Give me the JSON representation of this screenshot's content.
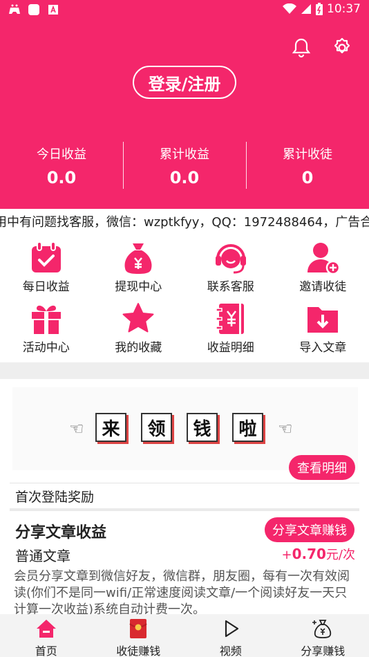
{
  "status_bar": {
    "time": "10:37"
  },
  "header": {
    "login_label": "登录/注册"
  },
  "stats": [
    {
      "label": "今日收益",
      "value": "0.0"
    },
    {
      "label": "累计收益",
      "value": "0.0"
    },
    {
      "label": "累计收徒",
      "value": "0"
    }
  ],
  "marquee": {
    "text": "用中有问题找客服，微信：wzptkfyy，QQ：1972488464，广告合"
  },
  "grid": [
    {
      "label": "每日收益",
      "icon": "calendar-check-icon"
    },
    {
      "label": "提现中心",
      "icon": "money-bag-icon"
    },
    {
      "label": "联系客服",
      "icon": "headset-icon"
    },
    {
      "label": "邀请收徒",
      "icon": "user-add-icon"
    },
    {
      "label": "活动中心",
      "icon": "gift-icon"
    },
    {
      "label": "我的收藏",
      "icon": "star-icon"
    },
    {
      "label": "收益明细",
      "icon": "ledger-icon"
    },
    {
      "label": "导入文章",
      "icon": "folder-import-icon"
    }
  ],
  "banner": {
    "chars": [
      "来",
      "领",
      "钱",
      "啦"
    ]
  },
  "card": {
    "detail_button": "查看明细",
    "first_login": "首次登陆奖励",
    "share_title": "分享文章收益",
    "share_button": "分享文章赚钱",
    "normal_article": "普通文章",
    "price_prefix": "+",
    "price_value": "0.70",
    "price_unit": "元/次",
    "description": "会员分享文章到微信好友，微信群，朋友圈，每有一次有效阅读(你们不是同一wifi/正常速度阅读文章/一个阅读好友一天只计算一次收益)系统自动计费一次。"
  },
  "tabs": [
    {
      "label": "首页",
      "icon": "home-icon"
    },
    {
      "label": "收徒赚钱",
      "icon": "red-envelope-icon"
    },
    {
      "label": "视频",
      "icon": "play-icon"
    },
    {
      "label": "分享赚钱",
      "icon": "money-bag-outline-icon"
    }
  ],
  "colors": {
    "primary": "#f4266b",
    "background": "#eeeeee"
  }
}
